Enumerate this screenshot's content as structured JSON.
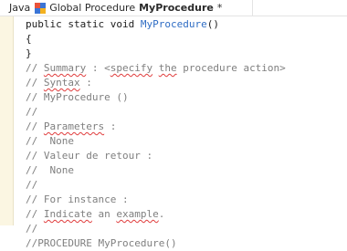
{
  "tab": {
    "part1": "Java",
    "part2": "Global Procedure",
    "part3": "MyProcedure",
    "part4": "*"
  },
  "code_lines": [
    {
      "a": "public static void ",
      "b": "MyProcedure",
      "c": "()"
    },
    {
      "a": "{"
    },
    {
      "a": "}"
    },
    {
      "a": "// ",
      "b": "Summary",
      "c": " : <",
      "d": "specify",
      "e": " ",
      "f": "the",
      "g": " procedure action>"
    },
    {
      "a": "// ",
      "b": "Syntax",
      "c": " :"
    },
    {
      "a": "// MyProcedure ()"
    },
    {
      "a": "//"
    },
    {
      "a": "// ",
      "b": "Parameters",
      "c": " :"
    },
    {
      "a": "//  None"
    },
    {
      "a": "// Valeur de retour :"
    },
    {
      "a": "//  None"
    },
    {
      "a": "//"
    },
    {
      "a": "// For instance :"
    },
    {
      "a": "// ",
      "b": "Indicate",
      "c": " an ",
      "d": "example",
      "e": "."
    },
    {
      "a": "//"
    },
    {
      "a": "//PROCEDURE MyProcedure()"
    }
  ],
  "colors": {
    "function_name": "#2f6dc4",
    "comment": "#7f7f7f",
    "gutter": "#fbf6e2",
    "squiggle": "#e03c3c"
  },
  "icons": [
    "procedure-tab-icon"
  ]
}
